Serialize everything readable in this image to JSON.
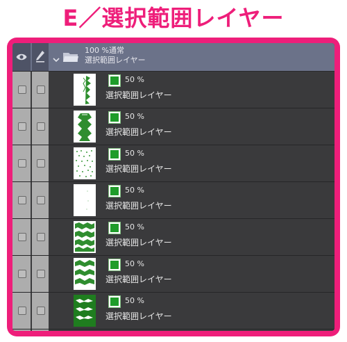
{
  "heading": "E／選択範囲レイヤー",
  "folder": {
    "opacity_mode": "100 %通常",
    "name": "選択範囲レイヤー"
  },
  "layers": [
    {
      "opacity": "50 %",
      "name": "選択範囲レイヤー"
    },
    {
      "opacity": "50 %",
      "name": "選択範囲レイヤー"
    },
    {
      "opacity": "50 %",
      "name": "選択範囲レイヤー"
    },
    {
      "opacity": "50 %",
      "name": "選択範囲レイヤー"
    },
    {
      "opacity": "50 %",
      "name": "選択範囲レイヤー"
    },
    {
      "opacity": "50 %",
      "name": "選択範囲レイヤー"
    },
    {
      "opacity": "50 %",
      "name": "選択範囲レイヤー"
    }
  ],
  "colors": {
    "accent": "#ee1e7a",
    "layer_color": "#1f9c2a",
    "panel_bg": "#3a3a3c",
    "folder_row_bg": "#6b7289"
  },
  "icons": {
    "visibility": "eye-icon",
    "lock": "pen-icon",
    "expand": "chevron-down-icon",
    "folder": "folder-icon",
    "layer_color": "color-chip-icon"
  }
}
